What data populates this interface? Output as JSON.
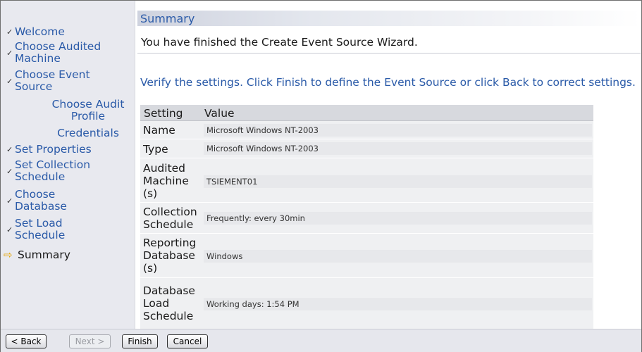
{
  "sidebar": {
    "items": [
      {
        "label": "Welcome",
        "mark": "✓"
      },
      {
        "label": "Choose Audited Machine",
        "mark": "✓"
      },
      {
        "label": "Choose Event Source",
        "mark": "✓"
      },
      {
        "label": "Choose Audit Profile",
        "mark": ""
      },
      {
        "label": "Credentials",
        "mark": ""
      },
      {
        "label": "Set Properties",
        "mark": "✓"
      },
      {
        "label": "Set Collection Schedule",
        "mark": "✓"
      },
      {
        "label": "Choose Database",
        "mark": "✓"
      },
      {
        "label": "Set Load Schedule",
        "mark": "✓"
      },
      {
        "label": "Summary",
        "mark": "⇨"
      }
    ]
  },
  "main": {
    "title": "Summary",
    "finished_text": "You have finished the Create Event Source Wizard.",
    "verify_text": "Verify the settings. Click Finish to define the Event Source or click Back to correct settings.",
    "table": {
      "headers": [
        "Setting",
        "Value"
      ],
      "rows": [
        {
          "setting": "Name",
          "value": "Microsoft Windows NT-2003"
        },
        {
          "setting": "Type",
          "value": "Microsoft Windows NT-2003"
        },
        {
          "setting": "Audited Machine (s)",
          "value": "TSIEMENT01"
        },
        {
          "setting": "Collection Schedule",
          "value": "Frequently: every 30min"
        },
        {
          "setting": "Reporting Database (s)",
          "value": "Windows"
        },
        {
          "setting": "Database Load Schedule",
          "value": "Working days: 1:54 PM"
        }
      ]
    }
  },
  "footer": {
    "back_label": "< Back",
    "next_label": "Next >",
    "finish_label": "Finish",
    "cancel_label": "Cancel"
  },
  "colors": {
    "link_blue": "#2a5aa8",
    "sidebar_bg": "#e8e9ef",
    "current_arrow": "#e6a500"
  }
}
